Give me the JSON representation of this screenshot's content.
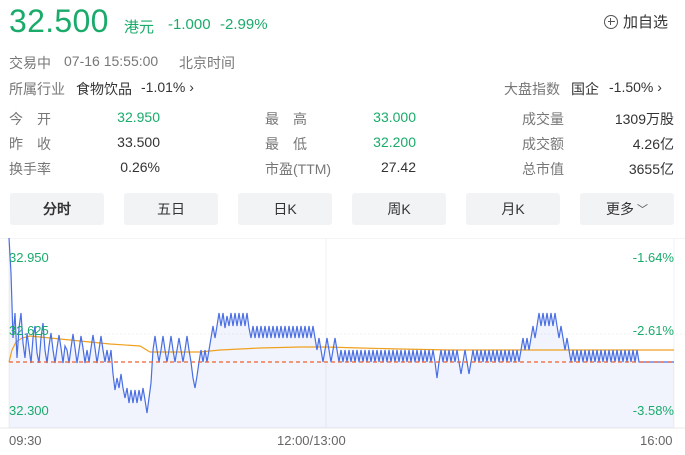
{
  "quote": {
    "price": "32.500",
    "currency": "港元",
    "change": "-1.000",
    "change_pct": "-2.99%",
    "add_watchlist": "加自选",
    "status": "交易中",
    "datetime": "07-16 15:55:00",
    "timezone": "北京时间"
  },
  "industry": {
    "label": "所属行业",
    "name": "食物饮品",
    "change": "-1.01%"
  },
  "market_index": {
    "label": "大盘指数",
    "name": "国企",
    "change": "-1.50%"
  },
  "stats": [
    {
      "label": "今　开",
      "value": "32.950",
      "color": "green"
    },
    {
      "label": "最　高",
      "value": "33.000",
      "color": "green"
    },
    {
      "label": "成交量",
      "value": "1309万股",
      "color": "dark"
    },
    {
      "label": "昨　收",
      "value": "33.500",
      "color": "dark"
    },
    {
      "label": "最　低",
      "value": "32.200",
      "color": "green"
    },
    {
      "label": "成交额",
      "value": "4.26亿",
      "color": "dark"
    },
    {
      "label": "换手率",
      "value": "0.26%",
      "color": "dark"
    },
    {
      "label": "市盈(TTM)",
      "value": "27.42",
      "color": "dark"
    },
    {
      "label": "总市值",
      "value": "3655亿",
      "color": "dark"
    }
  ],
  "tabs": [
    "分时",
    "五日",
    "日K",
    "周K",
    "月K",
    "更多"
  ],
  "active_tab": "分时",
  "chart": {
    "y_left": [
      "32.950",
      "32.625",
      "32.300"
    ],
    "y_right": [
      "-1.64%",
      "-2.61%",
      "-3.58%"
    ],
    "x_labels": [
      "09:30",
      "12:00/13:00",
      "16:00"
    ]
  },
  "chart_data": {
    "type": "line",
    "x": [
      "09:30",
      "12:00/13:00",
      "16:00"
    ],
    "ylim": [
      32.3,
      32.95
    ],
    "prev_close": 33.5,
    "series": [],
    "colors": {
      "price": "#4a6fe3",
      "avg": "#f0a020",
      "ref": "#f06030",
      "axis_text": "#1aab6b"
    }
  }
}
